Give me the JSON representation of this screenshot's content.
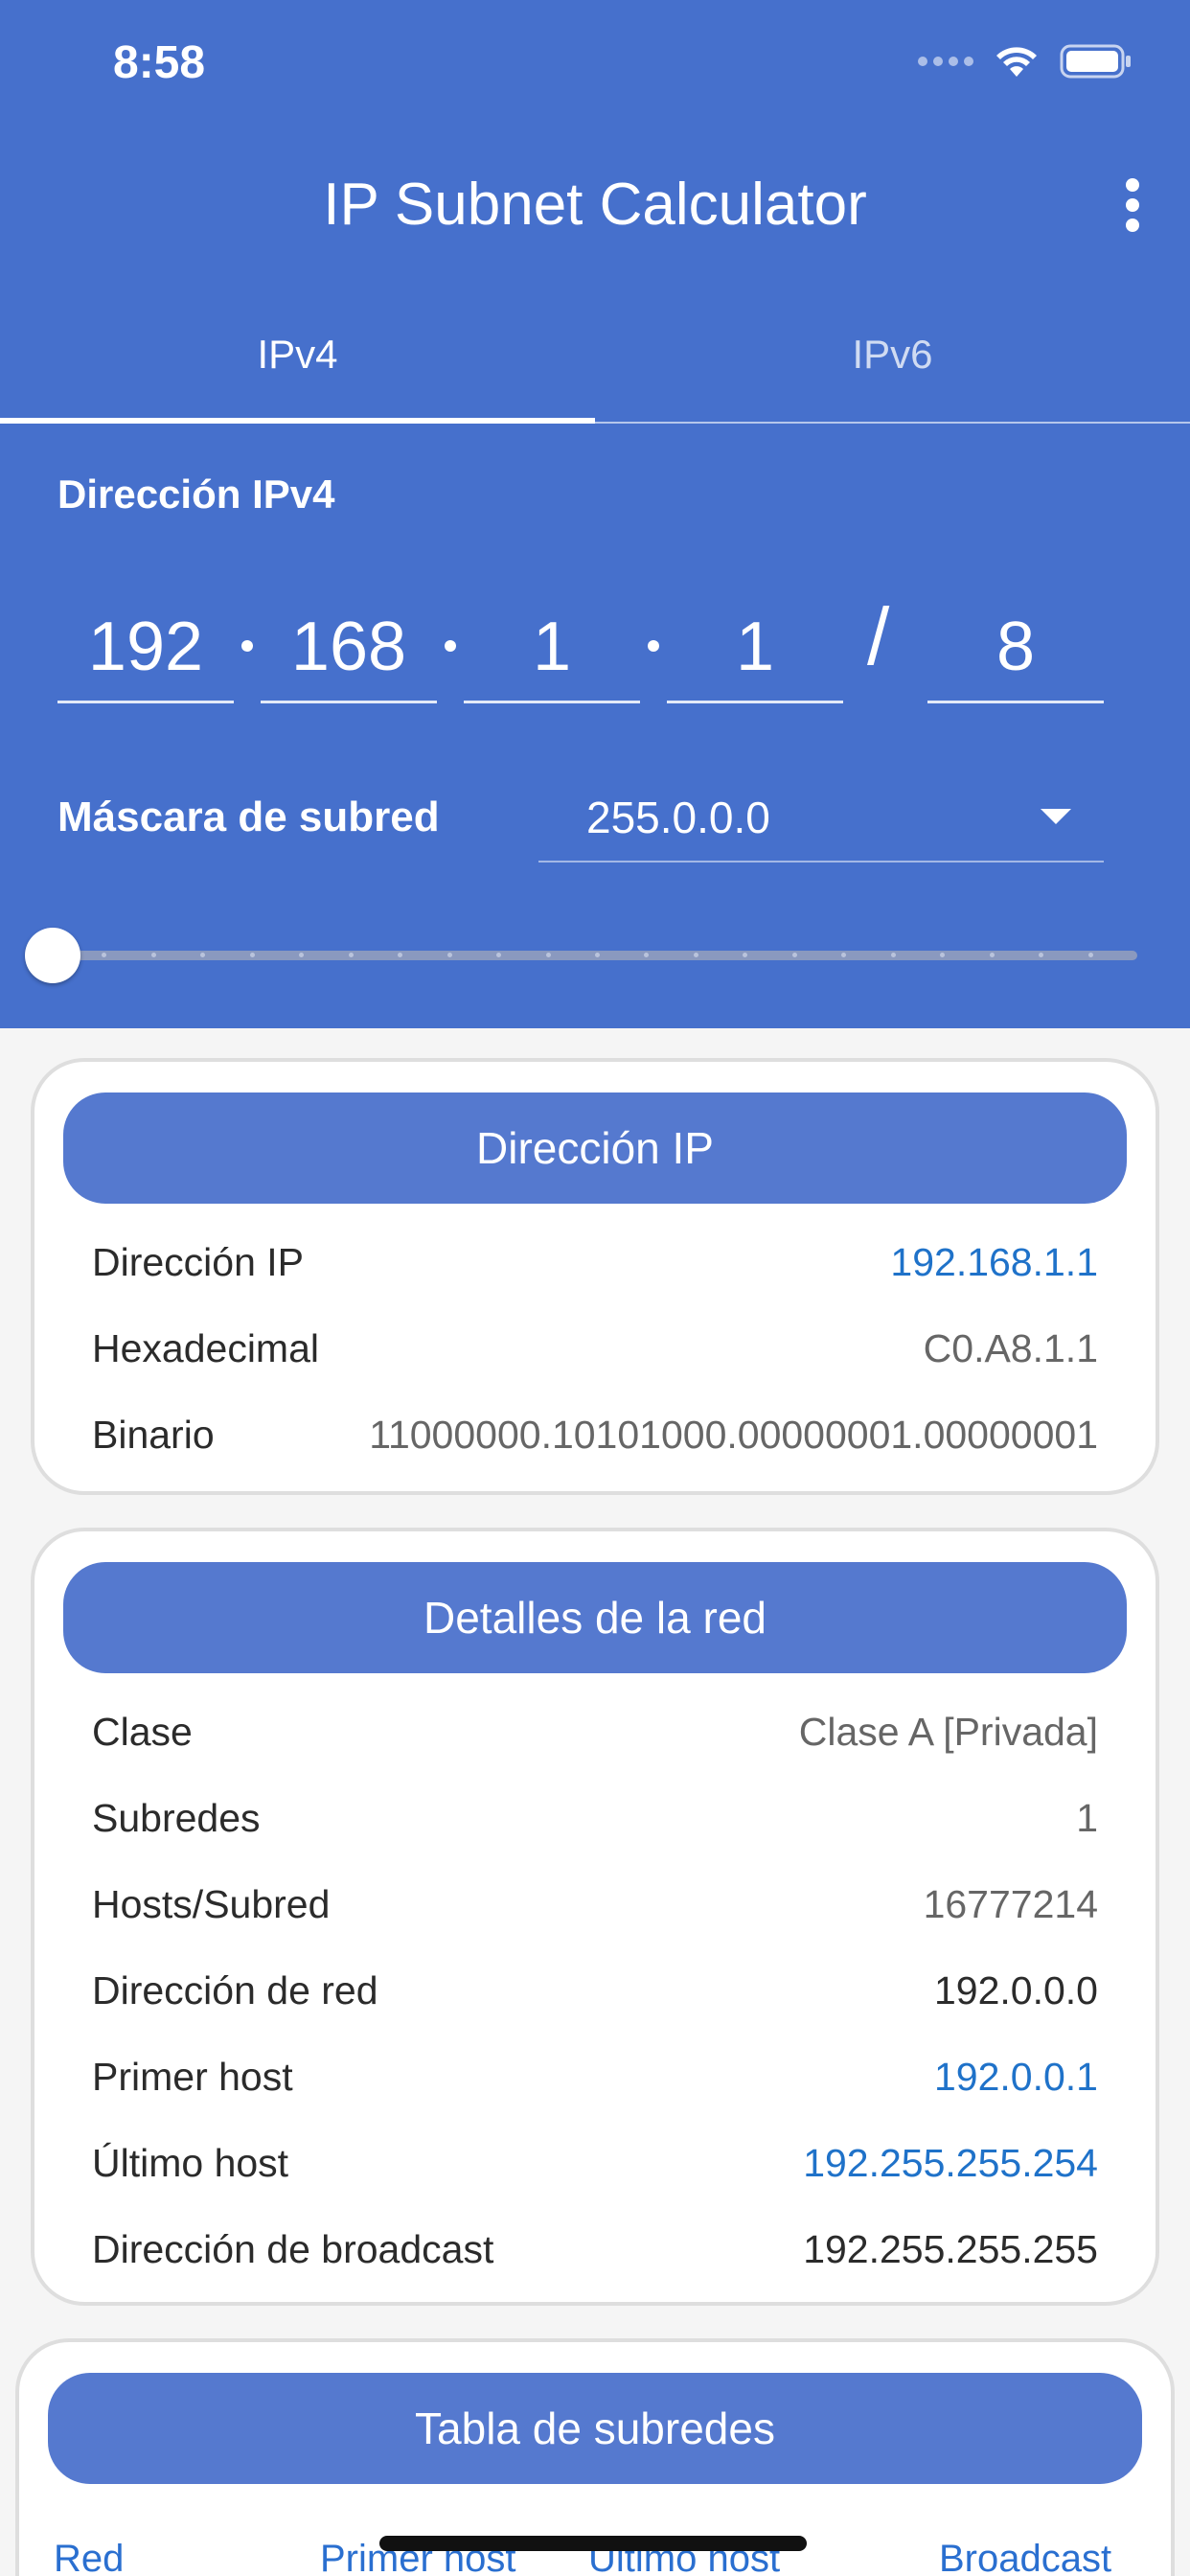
{
  "status_bar": {
    "time": "8:58"
  },
  "app": {
    "title": "IP Subnet Calculator"
  },
  "tabs": [
    {
      "label": "IPv4"
    },
    {
      "label": "IPv6"
    }
  ],
  "ipv4_input": {
    "label": "Dirección IPv4",
    "octets": [
      "192",
      "168",
      "1",
      "1"
    ],
    "separator": "/",
    "prefix": "8"
  },
  "subnet_mask": {
    "label": "Máscara de subred",
    "selected": "255.0.0.0"
  },
  "prefix_slider": {
    "value": 8,
    "min": 8,
    "max": 30
  },
  "card_ip": {
    "header": "Dirección IP",
    "rows": [
      {
        "key": "Dirección IP",
        "value": "192.168.1.1"
      },
      {
        "key": "Hexadecimal",
        "value": "C0.A8.1.1"
      },
      {
        "key": "Binario",
        "value": "11000000.10101000.00000001.00000001"
      }
    ]
  },
  "card_network": {
    "header": "Detalles de la red",
    "rows": [
      {
        "key": "Clase",
        "value": "Clase A [Privada]"
      },
      {
        "key": "Subredes",
        "value": "1"
      },
      {
        "key": "Hosts/Subred",
        "value": "16777214"
      },
      {
        "key": "Dirección de red",
        "value": "192.0.0.0"
      },
      {
        "key": "Primer host",
        "value": "192.0.0.1"
      },
      {
        "key": "Último host",
        "value": "192.255.255.254"
      },
      {
        "key": "Dirección de broadcast",
        "value": "192.255.255.255"
      }
    ]
  },
  "card_table": {
    "header": "Tabla de subredes",
    "columns": [
      "Red",
      "Primer host",
      "Último host",
      "Broadcast"
    ]
  },
  "colors": {
    "primary": "#4670cc",
    "card_header": "#5579cf",
    "link_blue": "#1f72c9"
  }
}
